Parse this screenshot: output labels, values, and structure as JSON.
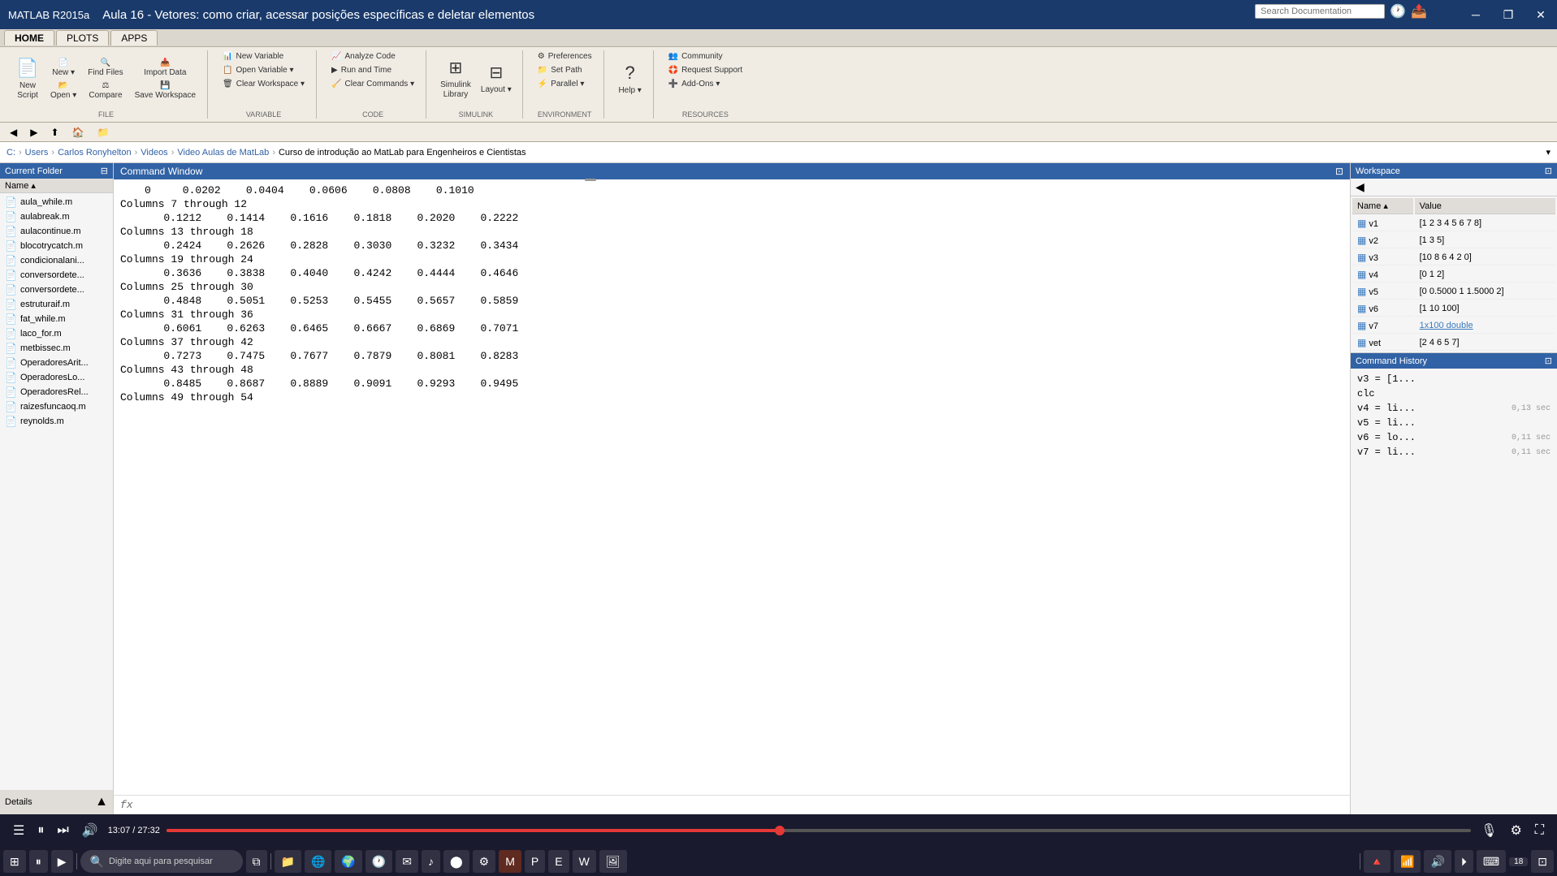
{
  "titleBar": {
    "title": "Aula 16 - Vetores: como criar, acessar posições específicas e deletar elementos",
    "appName": "MATLAB R2015a",
    "controls": [
      "minimize",
      "restore",
      "close"
    ]
  },
  "toolbar": {
    "tabs": [
      "HOME",
      "PLOTS",
      "APPS"
    ],
    "groups": {
      "file": {
        "label": "FILE",
        "buttons": [
          {
            "id": "new-script",
            "label": "New\nScript",
            "icon": "📄"
          },
          {
            "id": "new",
            "label": "New",
            "icon": "📄"
          },
          {
            "id": "open",
            "label": "Open",
            "icon": "📂"
          },
          {
            "id": "find-files",
            "label": "Find Files",
            "icon": "🔍"
          },
          {
            "id": "compare",
            "label": "Compare",
            "icon": "⚖"
          },
          {
            "id": "import-data",
            "label": "Import\nData",
            "icon": "📥"
          },
          {
            "id": "save-workspace",
            "label": "Save\nWorkspace",
            "icon": "💾"
          }
        ]
      },
      "variable": {
        "label": "VARIABLE",
        "buttons": [
          {
            "id": "new-variable",
            "label": "New Variable",
            "icon": "📊"
          },
          {
            "id": "open-variable",
            "label": "Open Variable ▾",
            "icon": ""
          },
          {
            "id": "clear-workspace",
            "label": "Clear Workspace ▾",
            "icon": ""
          }
        ]
      },
      "code": {
        "label": "CODE",
        "buttons": [
          {
            "id": "analyze-code",
            "label": "Analyze Code",
            "icon": ""
          },
          {
            "id": "run-and-time",
            "label": "Run and Time",
            "icon": ""
          },
          {
            "id": "clear-commands",
            "label": "Clear Commands ▾",
            "icon": ""
          }
        ]
      },
      "simulink": {
        "label": "SIMULINK",
        "buttons": [
          {
            "id": "simulink-library",
            "label": "Simulink\nLibrary",
            "icon": ""
          },
          {
            "id": "layout",
            "label": "Layout",
            "icon": ""
          }
        ]
      },
      "environment": {
        "label": "ENVIRONMENT",
        "buttons": [
          {
            "id": "preferences",
            "label": "Preferences",
            "icon": ""
          },
          {
            "id": "set-path",
            "label": "Set Path",
            "icon": ""
          },
          {
            "id": "parallel",
            "label": "Parallel ▾",
            "icon": ""
          },
          {
            "id": "help",
            "label": "Help",
            "icon": ""
          }
        ]
      },
      "resources": {
        "label": "RESOURCES",
        "buttons": [
          {
            "id": "community",
            "label": "Community",
            "icon": ""
          },
          {
            "id": "request-support",
            "label": "Request Support",
            "icon": ""
          },
          {
            "id": "add-ons",
            "label": "Add-Ons ▾",
            "icon": ""
          }
        ]
      }
    }
  },
  "breadcrumb": {
    "path": [
      "C:",
      "Users",
      "Carlos Ronyhelton",
      "Videos",
      "Video Aulas de MatLab",
      "Curso de introdução ao MatLab para Engenheiros e Cientistas"
    ]
  },
  "currentFolder": {
    "title": "Current Folder",
    "files": [
      "aula_while.m",
      "aulabreak.m",
      "aulacontinue.m",
      "blocotrycatch.m",
      "condicionalani...",
      "conversordete...",
      "conversordete...",
      "estruturaif.m",
      "fat_while.m",
      "laco_for.m",
      "metbissec.m",
      "OperadoresArit...",
      "OperadoresLo...",
      "OperadoresRel...",
      "raizesfuncaoq.m",
      "reynolds.m"
    ]
  },
  "commandWindow": {
    "title": "Command Window",
    "content": [
      {
        "type": "values",
        "text": "0    0.0202    0.0404    0.0606    0.0808    0.1010"
      },
      {
        "type": "columns",
        "text": "Columns 7 through 12"
      },
      {
        "type": "values",
        "text": "0.1212    0.1414    0.1616    0.1818    0.2020    0.2222"
      },
      {
        "type": "columns",
        "text": "Columns 13 through 18"
      },
      {
        "type": "values",
        "text": "0.2424    0.2626    0.2828    0.3030    0.3232    0.3434"
      },
      {
        "type": "columns",
        "text": "Columns 19 through 24"
      },
      {
        "type": "values",
        "text": "0.3636    0.3838    0.4040    0.4242    0.4444    0.4646"
      },
      {
        "type": "columns",
        "text": "Columns 25 through 30"
      },
      {
        "type": "values",
        "text": "0.4848    0.5051    0.5253    0.5455    0.5657    0.5859"
      },
      {
        "type": "columns",
        "text": "Columns 31 through 36"
      },
      {
        "type": "values",
        "text": "0.6061    0.6263    0.6465    0.6667    0.6869    0.7071"
      },
      {
        "type": "columns",
        "text": "Columns 37 through 42"
      },
      {
        "type": "values",
        "text": "0.7273    0.7475    0.7677    0.7879    0.8081    0.8283"
      },
      {
        "type": "columns",
        "text": "Columns 43 through 48"
      },
      {
        "type": "values",
        "text": "0.8485    0.8687    0.8889    0.9091    0.9293    0.9495"
      },
      {
        "type": "columns",
        "text": "Columns 49 through 54"
      }
    ],
    "prompt": "fx"
  },
  "workspace": {
    "title": "Workspace",
    "columns": [
      "Name",
      "Value"
    ],
    "variables": [
      {
        "name": "v1",
        "value": "[1 2 3 4 5 6 7 8]",
        "type": "array"
      },
      {
        "name": "v2",
        "value": "[1 3 5]",
        "type": "array"
      },
      {
        "name": "v3",
        "value": "[10 8 6 4 2 0]",
        "type": "array"
      },
      {
        "name": "v4",
        "value": "[0 1 2]",
        "type": "array"
      },
      {
        "name": "v5",
        "value": "[0 0.5000 1 1.5000 2]",
        "type": "array"
      },
      {
        "name": "v6",
        "value": "[1 10 100]",
        "type": "array"
      },
      {
        "name": "v7",
        "value": "1x100 double",
        "type": "array",
        "isLink": true
      },
      {
        "name": "vet",
        "value": "[2 4 6 5 7]",
        "type": "array"
      }
    ]
  },
  "commandHistory": {
    "title": "Command History",
    "items": [
      {
        "text": "v3 = [1...",
        "time": ""
      },
      {
        "text": "clc",
        "time": ""
      },
      {
        "text": "v4 = li...",
        "time": "0,13 sec"
      },
      {
        "text": "v5 = li...",
        "time": ""
      },
      {
        "text": "v6 = lo...",
        "time": "0,11 sec"
      },
      {
        "text": "v7 = li...",
        "time": "0,11 sec"
      }
    ]
  },
  "videoBar": {
    "currentTime": "13:07",
    "totalTime": "27:32",
    "progressPercent": 47,
    "controls": [
      "menu",
      "pause",
      "next",
      "volume",
      "time",
      "mic"
    ]
  },
  "taskbar": {
    "time": "18",
    "items": [
      "windows",
      "search",
      "taskview",
      "fileexplorer",
      "edge",
      "ie",
      "clock",
      "mail",
      "spotify",
      "chrome",
      "settings",
      "matlab",
      "powerpoint",
      "excel",
      "word",
      "notepad"
    ]
  }
}
